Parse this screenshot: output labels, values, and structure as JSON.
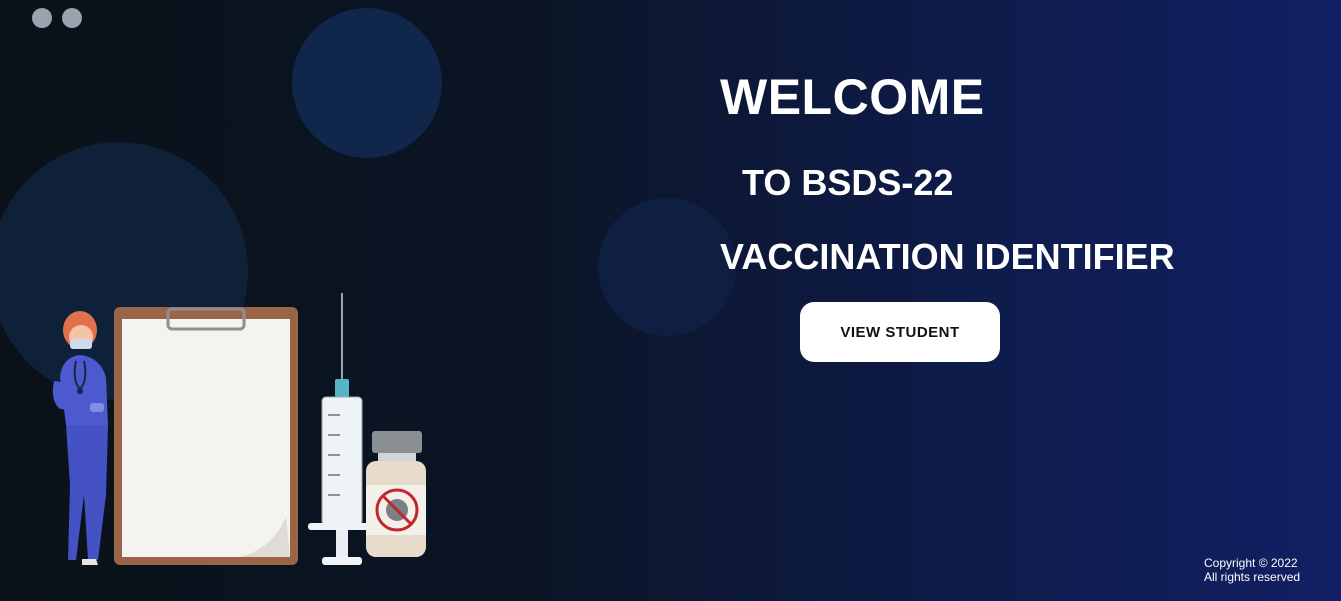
{
  "hero": {
    "welcome": "WELCOME",
    "subtitle": "TO BSDS-22",
    "app_name": "VACCINATION IDENTIFIER",
    "button_label": "VIEW STUDENT"
  },
  "illustration": {
    "description_icon": "nurse-clipboard-syringe-vaccine-illustration"
  },
  "footer": {
    "copyright": "Copyright © 2022",
    "rights": "All rights reserved"
  },
  "colors": {
    "background_start": "#0a1118",
    "background_end": "#121f64",
    "button_bg": "#ffffff",
    "text": "#ffffff"
  }
}
